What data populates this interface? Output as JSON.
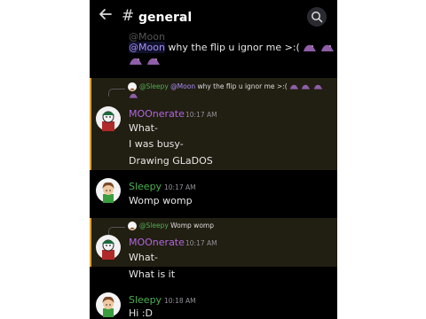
{
  "header": {
    "back_icon": "arrow-left-icon",
    "hash": "#",
    "channel": "general",
    "chevron": "›",
    "search_icon": "search-icon"
  },
  "messages": {
    "partial_name": "@Moon",
    "moon_msg": {
      "mention": "@Moon",
      "text": " why the flip u ignor me >:("
    },
    "m1": {
      "reply_author": "@Sleepy",
      "reply_mention": "@Moon",
      "reply_text": " why the flip u ignor me >:(",
      "author": "MOOnerate",
      "time": "10:17 AM",
      "lines": [
        "What-",
        "I was busy-",
        "Drawing GLaDOS"
      ]
    },
    "s1": {
      "author": "Sleepy",
      "time": "10:17 AM",
      "lines": [
        "Womp womp"
      ]
    },
    "m2": {
      "reply_author": "@Sleepy",
      "reply_text": " Womp womp",
      "author": "MOOnerate",
      "time": "10:17 AM",
      "lines": [
        "What-",
        "What is it"
      ]
    },
    "s2": {
      "author": "Sleepy",
      "time": "10:18 AM",
      "lines": [
        "Hi :D"
      ]
    }
  },
  "colors": {
    "moonerate_name": "#b266e0",
    "sleepy_name": "#4caf50",
    "mention": "#a88cf7",
    "highlight_bg": "#211e12",
    "highlight_bar": "#e0a52b"
  }
}
